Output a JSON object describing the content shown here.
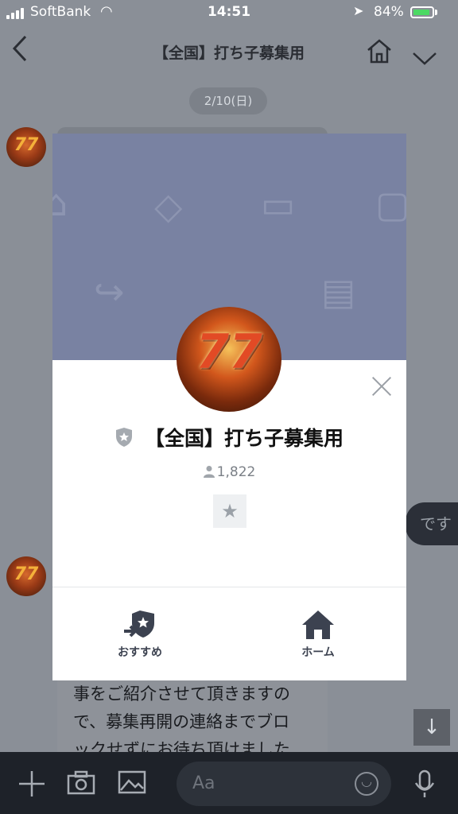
{
  "status_bar": {
    "carrier": "SoftBank",
    "time": "14:51",
    "battery_percent": "84%",
    "battery_level": 0.84
  },
  "header": {
    "title": "【全国】打ち子募集用",
    "back_icon": "chevron-left-icon",
    "home_icon": "home-icon",
    "menu_icon": "chevron-down-icon"
  },
  "chat": {
    "date_label": "2/10(日)",
    "outgoing_fragment": "です",
    "message_lines": [
      "事をご紹介させて頂きますの",
      "で、募集再開の連絡までブロ",
      "ックせずにお待ち頂けました"
    ]
  },
  "input_bar": {
    "placeholder": "Aa"
  },
  "modal": {
    "group_name": "【全国】打ち子募集用",
    "member_count": "1,822",
    "actions": [
      {
        "label": "おすすめ",
        "icon": "recommend-share-icon"
      },
      {
        "label": "ホーム",
        "icon": "home-icon"
      }
    ]
  },
  "colors": {
    "accent": "#3c4250",
    "cover": "#7982a2",
    "battery": "#4cd964"
  }
}
